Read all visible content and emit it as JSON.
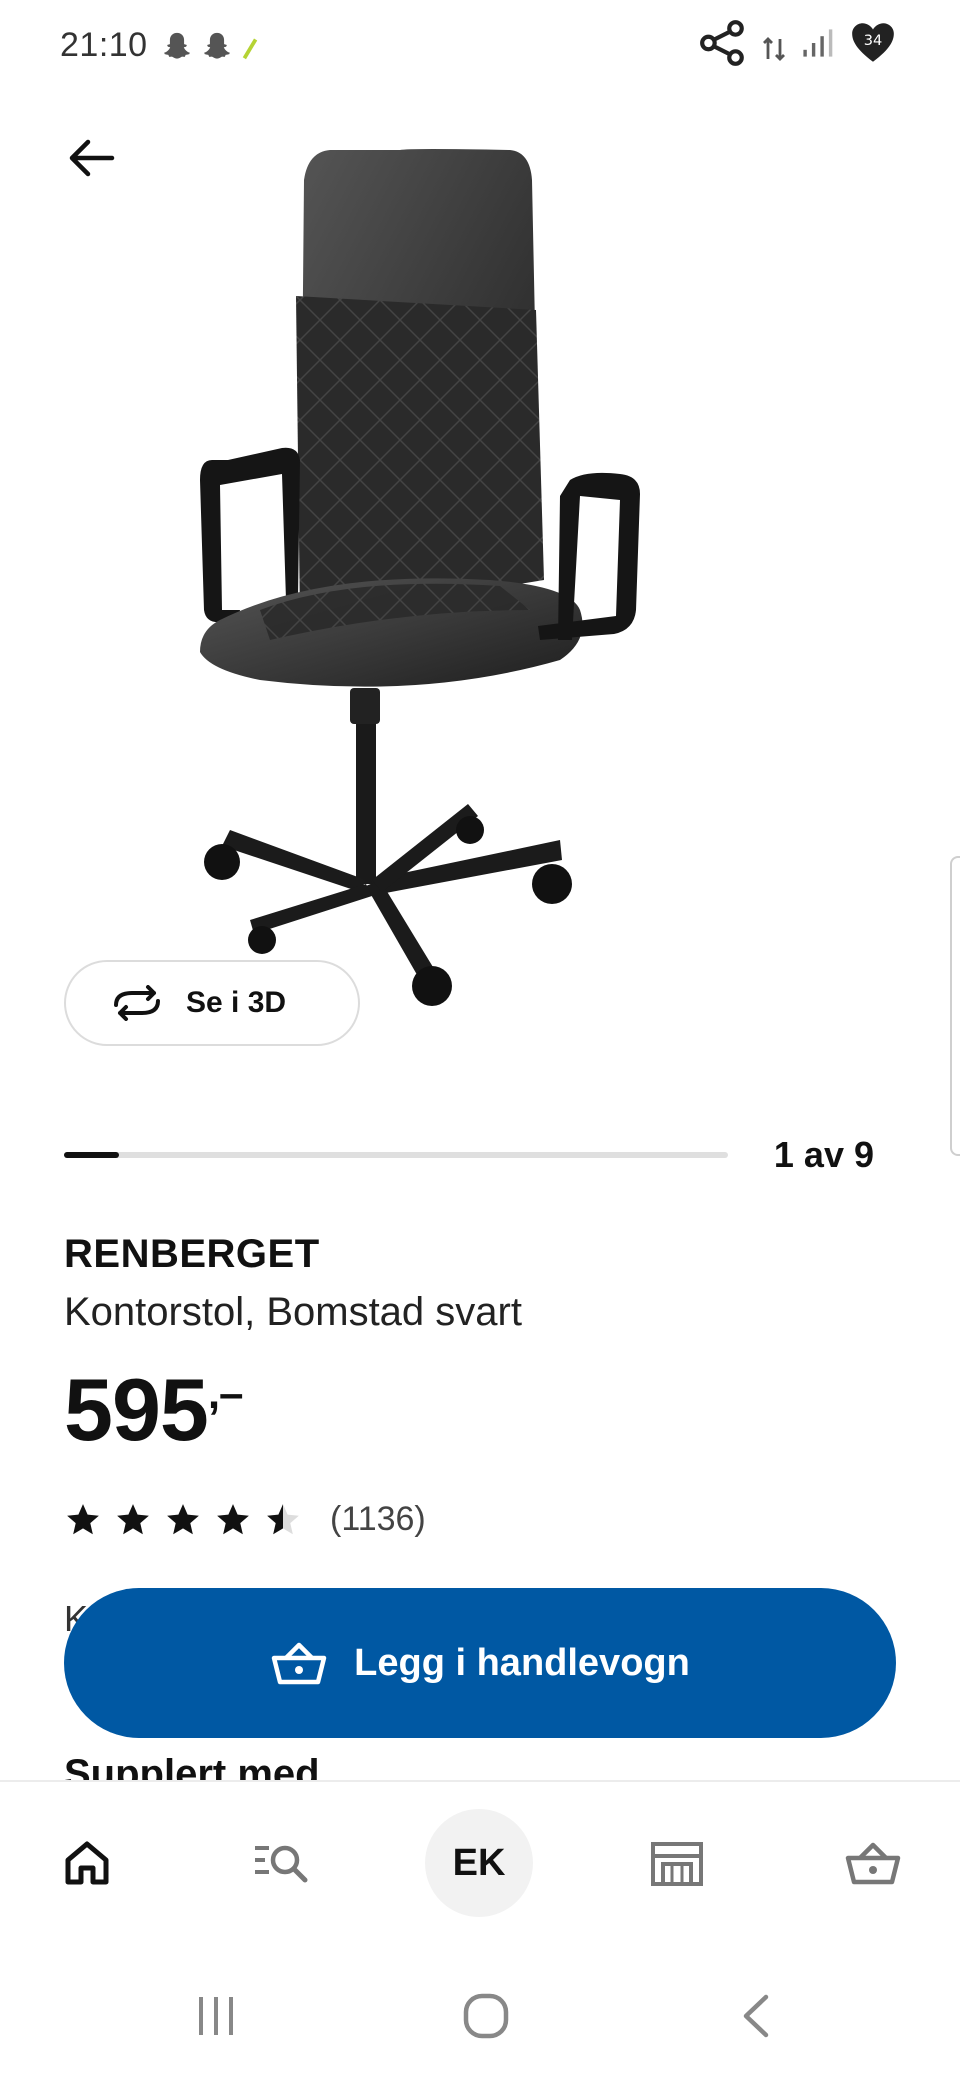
{
  "status_bar": {
    "time": "21:10",
    "notification_icons": [
      "snapchat-icon",
      "snapchat-icon",
      "signal-leaf-icon"
    ],
    "right_icons": [
      "share-network-icon",
      "data-arrows-icon",
      "cell-signal-icon",
      "battery-heart-icon"
    ]
  },
  "header": {
    "back_icon": "arrow-left-icon"
  },
  "gallery": {
    "view_3d_label": "Se i 3D",
    "view_3d_icon": "rotate-3d-icon",
    "counter": "1 av 9",
    "current": 1,
    "total": 9
  },
  "product": {
    "name": "RENBERGET",
    "description": "Kontorstol, Bomstad svart",
    "price": "595",
    "price_suffix": ",–",
    "rating": 4.5,
    "rating_max": 5,
    "review_count": "(1136)",
    "partial_label": "K",
    "section_heading": "Supplert med"
  },
  "actions": {
    "add_to_cart_label": "Legg i handlevogn",
    "add_to_cart_icon": "basket-icon",
    "accent": "#0058a3"
  },
  "bottom_nav": {
    "items": [
      {
        "name": "home",
        "icon": "home-icon"
      },
      {
        "name": "search",
        "icon": "search-list-icon"
      },
      {
        "name": "profile",
        "label": "EK"
      },
      {
        "name": "stores",
        "icon": "store-icon"
      },
      {
        "name": "cart",
        "icon": "basket-icon"
      }
    ]
  },
  "system_nav": [
    "recent-apps-icon",
    "home-circle-icon",
    "back-chevron-icon"
  ]
}
